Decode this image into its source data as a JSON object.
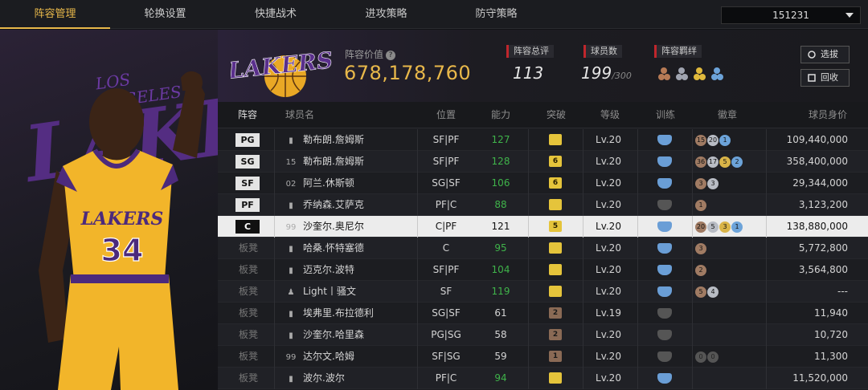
{
  "nav": {
    "tabs": [
      "阵容管理",
      "轮换设置",
      "快捷战术",
      "进攻策略",
      "防守策略"
    ],
    "active_index": 0,
    "team_select": "151231"
  },
  "player_art": {
    "jersey_team": "LAKERS",
    "jersey_number": "34"
  },
  "header": {
    "logo_text": "LAKERS",
    "value_label": "阵容价值",
    "value": "678,178,760",
    "stats": [
      {
        "label": "阵容总评",
        "value": "113"
      },
      {
        "label": "球员数",
        "value": "199",
        "suffix": "/300"
      },
      {
        "label": "阵容羁绊"
      }
    ],
    "buttons": {
      "pick": "选拔",
      "recycle": "回收"
    }
  },
  "table": {
    "headers": [
      "阵容",
      "球员名",
      "位置",
      "能力",
      "突破",
      "等级",
      "训练",
      "徽章",
      "球员身价"
    ],
    "rows": [
      {
        "slot": "PG",
        "num": "",
        "name": "勒布朗.詹姆斯",
        "pos": "SF|PF",
        "ability": "127",
        "green": true,
        "brk": "",
        "brk_color": "gold",
        "level": "Lv.20",
        "train": true,
        "badges": [
          [
            "15",
            "br"
          ],
          [
            "20",
            "si"
          ],
          [
            "1",
            "bl"
          ]
        ],
        "worth": "109,440,000"
      },
      {
        "slot": "SG",
        "num": "15",
        "name": "勒布朗.詹姆斯",
        "pos": "SF|PF",
        "ability": "128",
        "green": true,
        "brk": "6",
        "brk_color": "gold",
        "level": "Lv.20",
        "train": true,
        "badges": [
          [
            "36",
            "br"
          ],
          [
            "17",
            "si"
          ],
          [
            "5",
            "go"
          ],
          [
            "2",
            "bl"
          ]
        ],
        "worth": "358,400,000"
      },
      {
        "slot": "SF",
        "num": "02",
        "name": "阿兰.休斯顿",
        "pos": "SG|SF",
        "ability": "106",
        "green": true,
        "brk": "6",
        "brk_color": "gold",
        "level": "Lv.20",
        "train": true,
        "badges": [
          [
            "3",
            "br"
          ],
          [
            "3",
            "si"
          ]
        ],
        "worth": "29,344,000"
      },
      {
        "slot": "PF",
        "num": "",
        "name": "乔纳森.艾萨克",
        "pos": "PF|C",
        "ability": "88",
        "green": true,
        "brk": "",
        "brk_color": "gold",
        "level": "Lv.20",
        "train": false,
        "badges": [
          [
            "1",
            "br"
          ]
        ],
        "worth": "3,123,200"
      },
      {
        "slot": "C",
        "num": "99",
        "name": "沙奎尔.奥尼尔",
        "pos": "C|PF",
        "ability": "121",
        "green": false,
        "brk": "5",
        "brk_color": "gold",
        "level": "Lv.20",
        "train": true,
        "badges": [
          [
            "20",
            "br"
          ],
          [
            "5",
            "si"
          ],
          [
            "3",
            "go"
          ],
          [
            "1",
            "bl"
          ]
        ],
        "worth": "138,880,000",
        "selected": true
      },
      {
        "slot": "板凳",
        "num": "",
        "name": "哈桑.怀特塞德",
        "pos": "C",
        "ability": "95",
        "green": true,
        "brk": "",
        "brk_color": "gold",
        "level": "Lv.20",
        "train": true,
        "badges": [
          [
            "3",
            "br"
          ]
        ],
        "worth": "5,772,800"
      },
      {
        "slot": "板凳",
        "num": "",
        "name": "迈克尔.波特",
        "pos": "SF|PF",
        "ability": "104",
        "green": true,
        "brk": "",
        "brk_color": "gold",
        "level": "Lv.20",
        "train": true,
        "badges": [
          [
            "2",
            "br"
          ]
        ],
        "worth": "3,564,800"
      },
      {
        "slot": "板凳",
        "num": "",
        "name": "Light丨骚文",
        "pos": "SF",
        "ability": "119",
        "green": true,
        "brk": "",
        "brk_color": "gold",
        "level": "Lv.20",
        "train": true,
        "badges": [
          [
            "5",
            "br"
          ],
          [
            "4",
            "si"
          ]
        ],
        "worth": "---"
      },
      {
        "slot": "板凳",
        "num": "",
        "name": "埃弗里.布拉德利",
        "pos": "SG|SF",
        "ability": "61",
        "green": false,
        "brk": "2",
        "brk_color": "brown",
        "level": "Lv.19",
        "train": false,
        "badges": [],
        "worth": "11,940"
      },
      {
        "slot": "板凳",
        "num": "",
        "name": "沙奎尔.哈里森",
        "pos": "PG|SG",
        "ability": "58",
        "green": false,
        "brk": "2",
        "brk_color": "brown",
        "level": "Lv.20",
        "train": false,
        "badges": [],
        "worth": "10,720"
      },
      {
        "slot": "板凳",
        "num": "99",
        "name": "达尔文.哈姆",
        "pos": "SF|SG",
        "ability": "59",
        "green": false,
        "brk": "1",
        "brk_color": "brown",
        "level": "Lv.20",
        "train": false,
        "badges": [
          [
            "0",
            "gr"
          ],
          [
            "0",
            "gr"
          ]
        ],
        "worth": "11,300"
      },
      {
        "slot": "板凳",
        "num": "",
        "name": "波尔.波尔",
        "pos": "PF|C",
        "ability": "94",
        "green": true,
        "brk": "",
        "brk_color": "gold",
        "level": "Lv.20",
        "train": true,
        "badges": [],
        "worth": "11,520,000"
      }
    ]
  }
}
